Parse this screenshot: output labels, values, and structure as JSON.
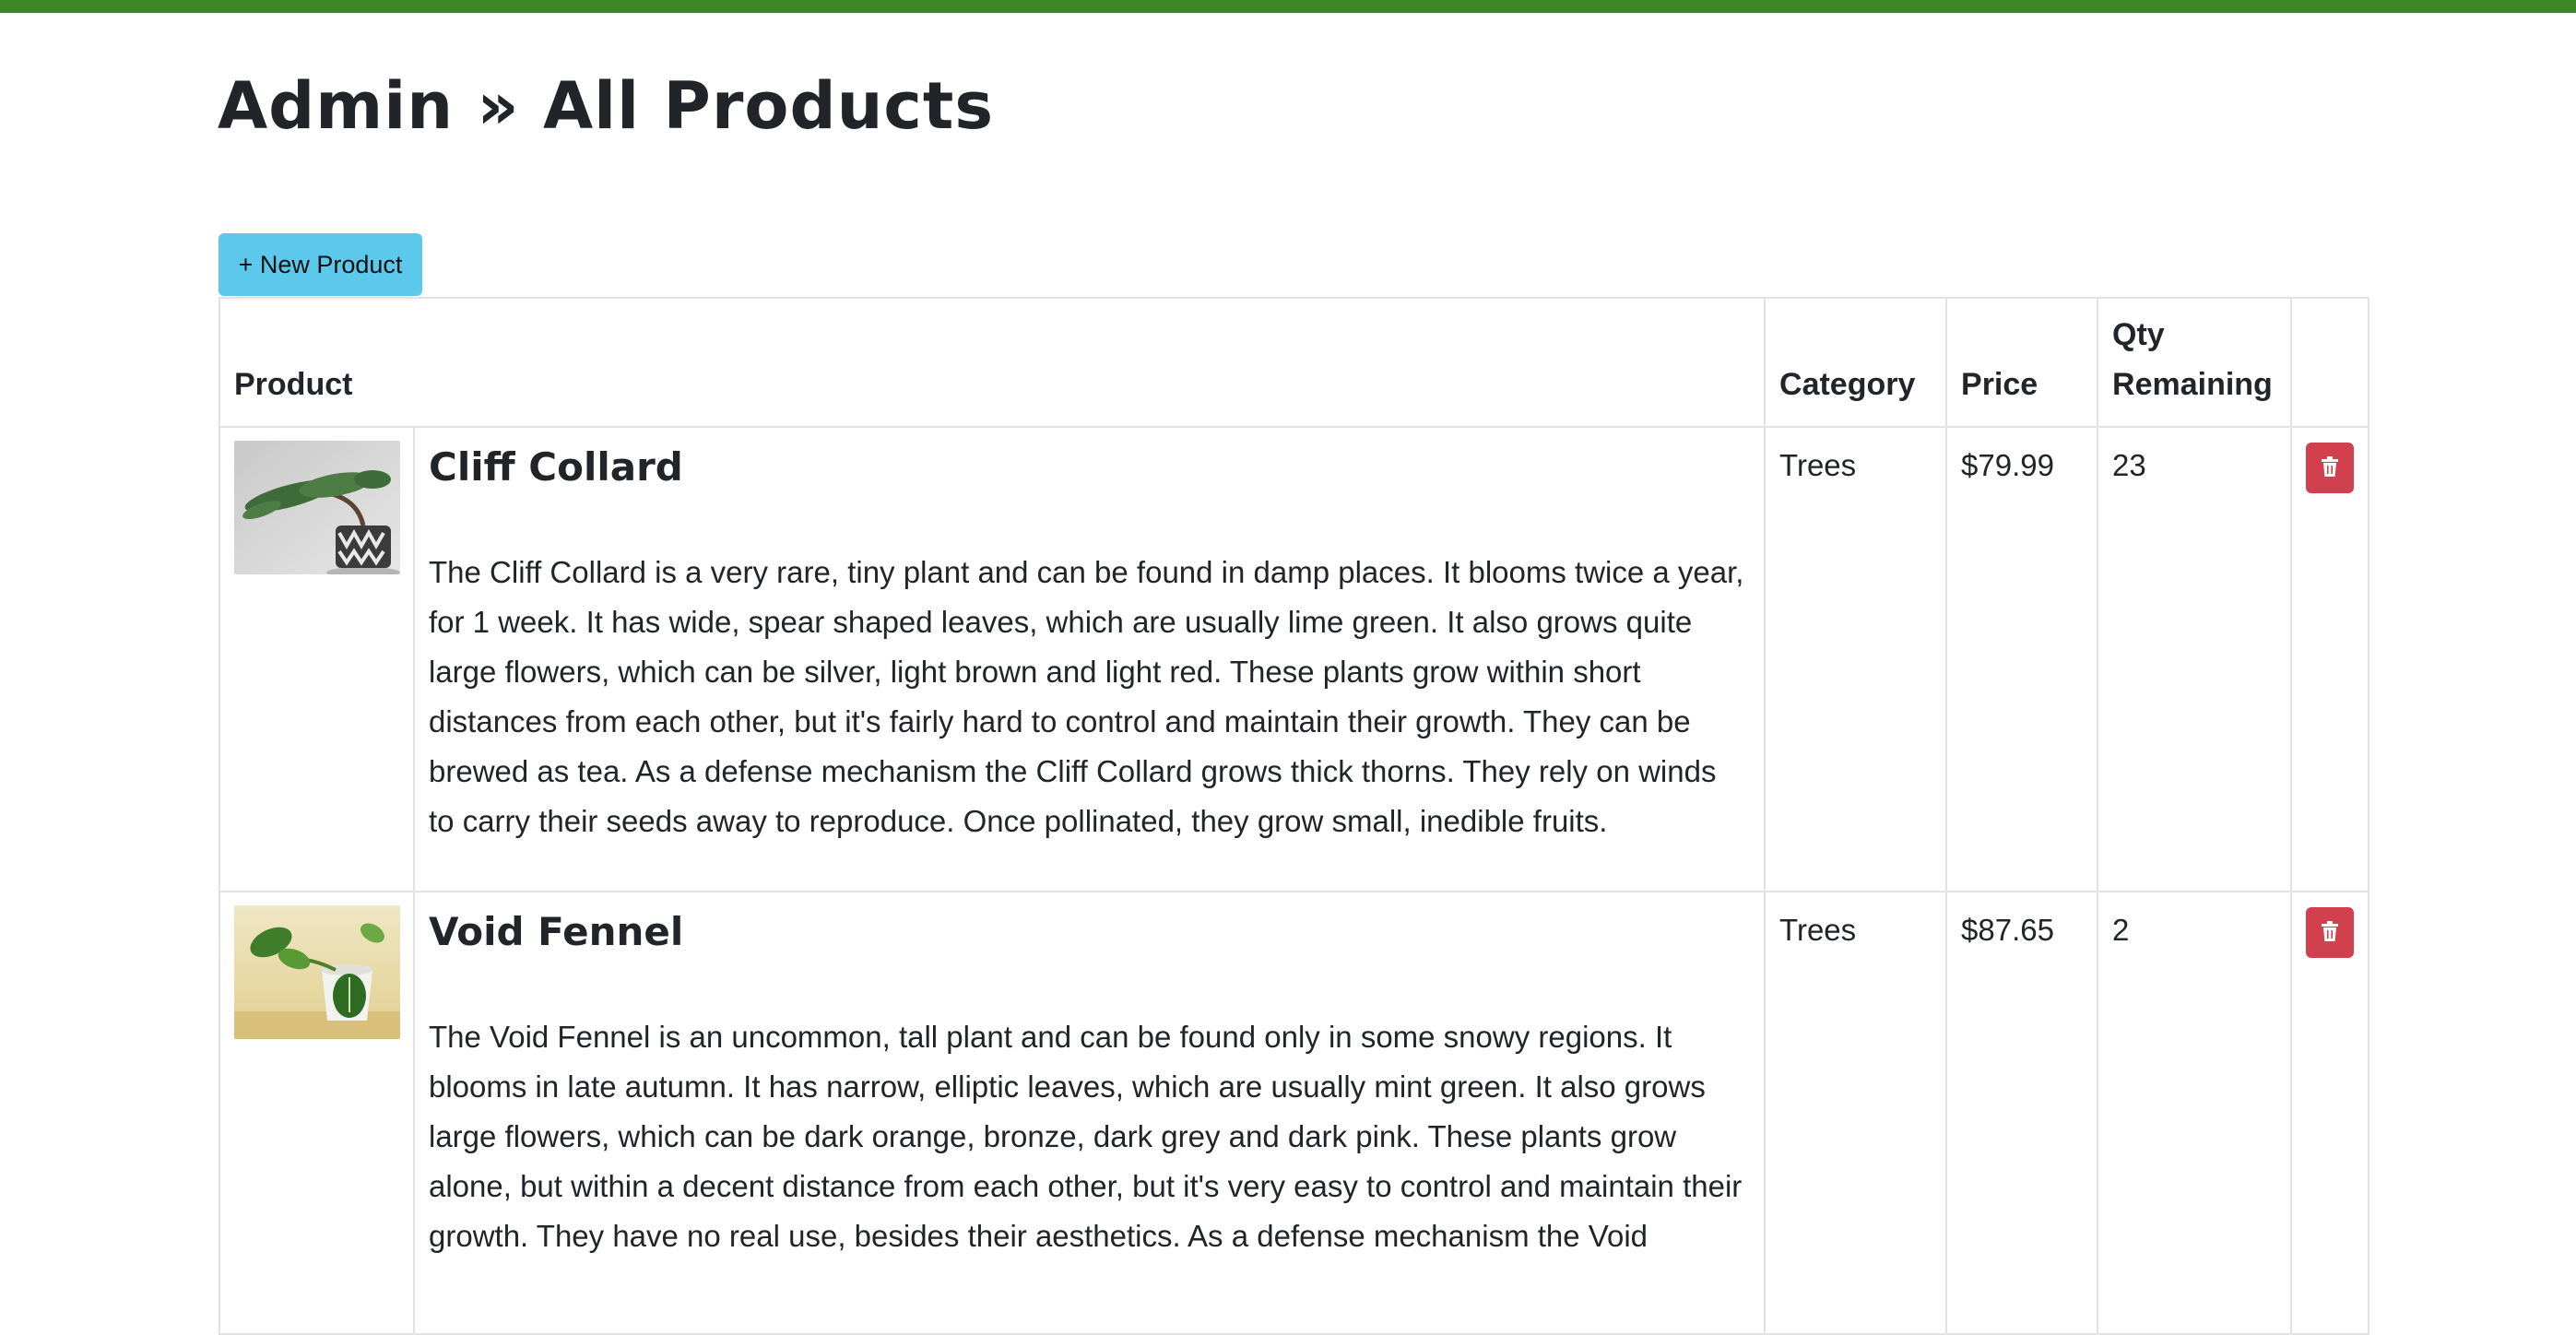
{
  "page": {
    "title": "Admin » All Products",
    "new_button_label": "+ New Product"
  },
  "colors": {
    "topbar": "#3e8527",
    "new_button": "#5bc8ec",
    "delete_button": "#d0414d"
  },
  "table": {
    "headers": {
      "product": "Product",
      "category": "Category",
      "price": "Price",
      "qty": "Qty Remaining"
    },
    "rows": [
      {
        "image_icon": "bonsai-plant-image",
        "name": "Cliff Collard",
        "description": "The Cliff Collard is a very rare, tiny plant and can be found in damp places. It blooms twice a year, for 1 week. It has wide, spear shaped leaves, which are usually lime green. It also grows quite large flowers, which can be silver, light brown and light red. These plants grow within short distances from each other, but it's fairly hard to control and maintain their growth. They can be brewed as tea. As a defense mechanism the Cliff Collard grows thick thorns. They rely on winds to carry their seeds away to reproduce. Once pollinated, they grow small, inedible fruits.",
        "category": "Trees",
        "price": "$79.99",
        "qty": "23",
        "delete_icon": "trash-icon"
      },
      {
        "image_icon": "potted-plant-image",
        "name": "Void Fennel",
        "description": "The Void Fennel is an uncommon, tall plant and can be found only in some snowy regions. It blooms in late autumn. It has narrow, elliptic leaves, which are usually mint green. It also grows large flowers, which can be dark orange, bronze, dark grey and dark pink. These plants grow alone, but within a decent distance from each other, but it's very easy to control and maintain their growth. They have no real use, besides their aesthetics. As a defense mechanism the Void",
        "category": "Trees",
        "price": "$87.65",
        "qty": "2",
        "delete_icon": "trash-icon"
      }
    ]
  }
}
